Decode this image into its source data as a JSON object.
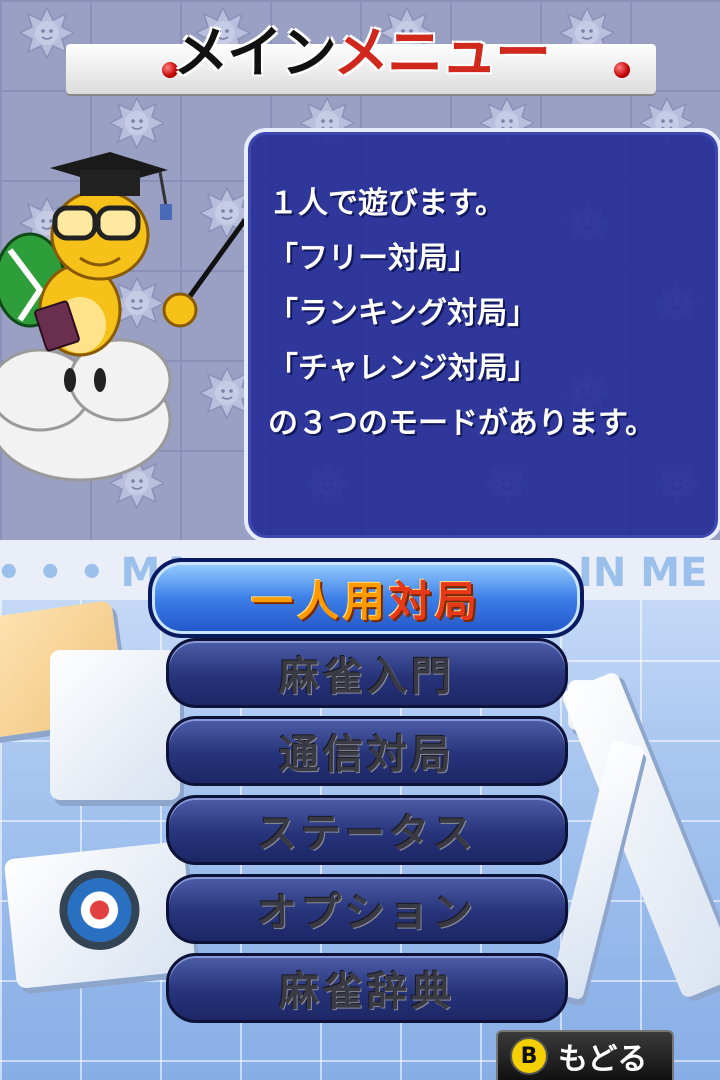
{
  "top_screen": {
    "title_part1": "メイン",
    "title_part2": "メニュー",
    "info_lines": [
      "１人で遊びます。",
      "「フリー対局」",
      "「ランキング対局」",
      "「チャレンジ対局」",
      "の３つのモードがあります。"
    ],
    "colors": {
      "title_accent": "#d0281c",
      "info_box": "#262e96"
    }
  },
  "bottom_screen": {
    "banner_left": "• • • MA",
    "banner_right": "IN ME",
    "menu": {
      "selected_part1": "一人用",
      "selected_part2": "対局",
      "items": [
        "麻雀入門",
        "通信対局",
        "ステータス",
        "オプション",
        "麻雀辞典"
      ]
    },
    "back_button": {
      "icon": "B",
      "label": "もどる"
    }
  }
}
